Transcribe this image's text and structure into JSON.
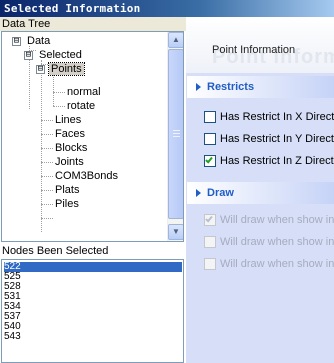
{
  "window": {
    "title": "Selected Information"
  },
  "tree_panel": {
    "label": "Data Tree",
    "nodes": [
      {
        "label": "Data",
        "expander": "⊟"
      },
      {
        "label": "Selected",
        "expander": "⊟"
      },
      {
        "label": "Points",
        "expander": "⊟",
        "selected": true
      },
      {
        "label": "normal"
      },
      {
        "label": "rotate"
      },
      {
        "label": "Lines"
      },
      {
        "label": "Faces"
      },
      {
        "label": "Blocks"
      },
      {
        "label": "Joints"
      },
      {
        "label": "COM3Bonds"
      },
      {
        "label": "Plats"
      },
      {
        "label": "Piles"
      }
    ]
  },
  "nodes_panel": {
    "label": "Nodes Been Selected",
    "items": [
      "522",
      "525",
      "528",
      "531",
      "534",
      "537",
      "540",
      "543"
    ],
    "selected_index": 0
  },
  "info": {
    "title": "Point Information",
    "watermark": "Point Informa"
  },
  "restricts": {
    "title": "Restricts",
    "options": [
      {
        "label": "Has Restrict In X Direction",
        "checked": false
      },
      {
        "label": "Has Restrict In Y Direction",
        "checked": false
      },
      {
        "label": "Has Restrict In Z Direction",
        "checked": true
      }
    ]
  },
  "draw": {
    "title": "Draw",
    "options": [
      {
        "label": "Will draw when show in m",
        "checked": true,
        "disabled": true
      },
      {
        "label": "Will draw when show in m",
        "checked": false,
        "disabled": true
      },
      {
        "label": "Will draw when show in m",
        "checked": false,
        "disabled": true
      }
    ]
  },
  "colors": {
    "title_bar": "#0a246a",
    "task_panel_bg": "#d6dff7",
    "group_header_text": "#215dc6",
    "list_selection": "#316ac5"
  }
}
